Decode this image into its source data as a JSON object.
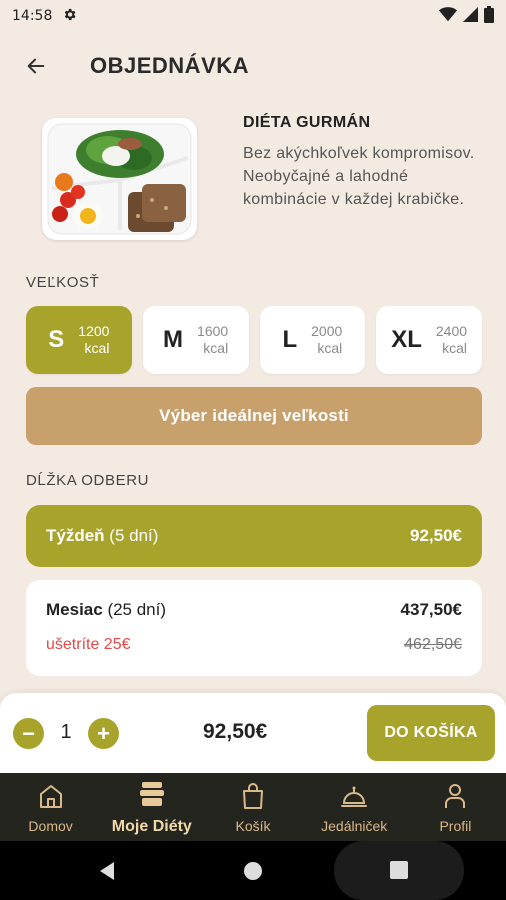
{
  "status": {
    "time": "14:58"
  },
  "header": {
    "title": "OBJEDNÁVKA"
  },
  "product": {
    "name": "DIÉTA GURMÁN",
    "description": "Bez akýchkoľvek kompromisov. Neobyčajné a lahodné kombinácie v každej krabičke."
  },
  "size_section": {
    "label": "VEĽKOSŤ",
    "options": [
      {
        "letter": "S",
        "kcal_value": "1200",
        "kcal_unit": "kcal",
        "selected": true
      },
      {
        "letter": "M",
        "kcal_value": "1600",
        "kcal_unit": "kcal",
        "selected": false
      },
      {
        "letter": "L",
        "kcal_value": "2000",
        "kcal_unit": "kcal",
        "selected": false
      },
      {
        "letter": "XL",
        "kcal_value": "2400",
        "kcal_unit": "kcal",
        "selected": false
      }
    ],
    "ideal_button": "Výber ideálnej veľkosti"
  },
  "duration_section": {
    "label": "DĹŽKA ODBERU",
    "options": [
      {
        "name": "Týždeň",
        "detail": "(5 dní)",
        "price": "92,50€",
        "selected": true
      },
      {
        "name": "Mesiac",
        "detail": "(25 dní)",
        "price": "437,50€",
        "saving": "ušetríte 25€",
        "old_price": "462,50€",
        "selected": false
      }
    ]
  },
  "cart": {
    "minus": "−",
    "plus": "+",
    "quantity": "1",
    "total": "92,50€",
    "add_button": "DO KOŠÍKA"
  },
  "tabs": [
    {
      "label": "Domov",
      "icon": "home-icon",
      "active": false
    },
    {
      "label": "Moje Diéty",
      "icon": "food-boxes-icon",
      "active": true
    },
    {
      "label": "Košík",
      "icon": "shopping-bag-icon",
      "active": false
    },
    {
      "label": "Jedálniček",
      "icon": "cloche-icon",
      "active": false
    },
    {
      "label": "Profil",
      "icon": "person-icon",
      "active": false
    }
  ],
  "colors": {
    "accent": "#a8a42b",
    "ideal_button": "#c8a06c",
    "background": "#f3ebe2",
    "tabbar": "#25251f",
    "saving": "#e24a4a"
  }
}
